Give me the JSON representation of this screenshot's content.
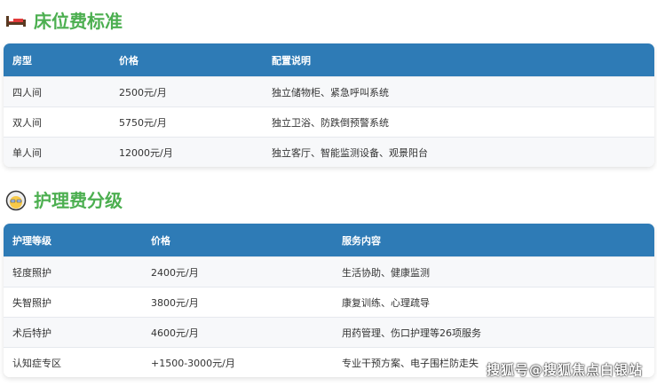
{
  "bed": {
    "title": "床位费标准",
    "icon": "bed-icon",
    "headers": [
      "房型",
      "价格",
      "配置说明"
    ],
    "rows": [
      [
        "四人间",
        "2500元/月",
        "独立储物柜、紧急呼叫系统"
      ],
      [
        "双人间",
        "5750元/月",
        "独立卫浴、防跌倒预警系统"
      ],
      [
        "单人间",
        "12000元/月",
        "独立客厅、智能监测设备、观景阳台"
      ]
    ]
  },
  "care": {
    "title": "护理费分级",
    "icon": "older-person-icon",
    "headers": [
      "护理等级",
      "价格",
      "服务内容"
    ],
    "rows": [
      [
        "轻度照护",
        "2400元/月",
        "生活协助、健康监测"
      ],
      [
        "失智照护",
        "3800元/月",
        "康复训练、心理疏导"
      ],
      [
        "术后特护",
        "4600元/月",
        "用药管理、伤口护理等26项服务"
      ],
      [
        "认知症专区",
        "+1500-3000元/月",
        "专业干预方案、电子围栏防走失"
      ]
    ]
  },
  "watermark": "搜狐号@搜狐焦点白银站",
  "colors": {
    "accent": "#4caf50",
    "header": "#2e7bb6"
  }
}
